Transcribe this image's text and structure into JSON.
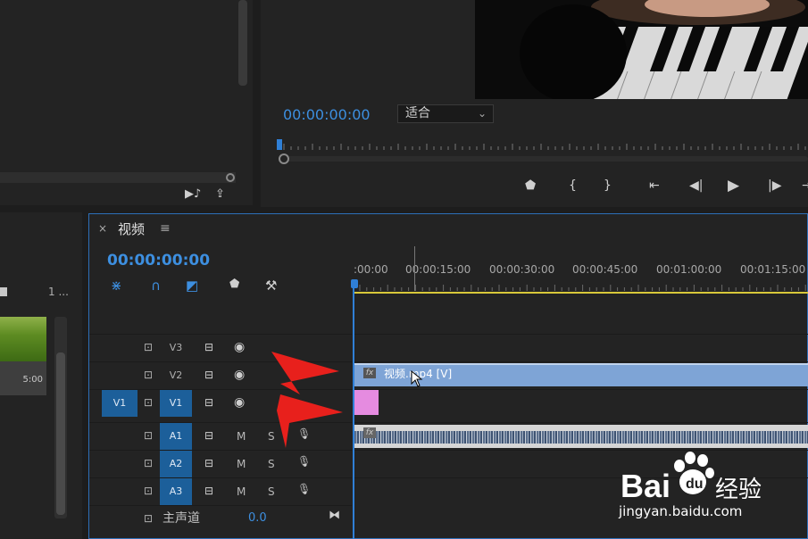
{
  "program_monitor": {
    "timecode": "00:00:00:00",
    "fit_dropdown": {
      "selected": "适合"
    }
  },
  "project_panel": {
    "column_header": "1 ...",
    "clip_duration": "5:00"
  },
  "timeline": {
    "tab_title": "视频",
    "close_glyph": "×",
    "menu_glyph": "≡",
    "timecode": "00:00:00:00",
    "ruler_labels": [
      ":00:00",
      "00:00:15:00",
      "00:00:30:00",
      "00:00:45:00",
      "00:01:00:00",
      "00:01:15:00"
    ],
    "video_tracks": [
      {
        "name": "V3",
        "targeted": false
      },
      {
        "name": "V2",
        "targeted": false
      },
      {
        "name": "V1",
        "targeted": true,
        "source": "V1"
      }
    ],
    "audio_tracks": [
      {
        "name": "A1",
        "mute": "M",
        "solo": "S"
      },
      {
        "name": "A2",
        "mute": "M",
        "solo": "S"
      },
      {
        "name": "A3",
        "mute": "M",
        "solo": "S"
      }
    ],
    "master": {
      "label": "主声道",
      "value": "0.0"
    },
    "clip_v2_label": "视频.mp4 [V]",
    "fx_badge": "fx"
  },
  "icons": {
    "lock": "lock-icon",
    "eye": "eye-icon",
    "sync": "sync-lock-icon",
    "mic": "microphone-icon"
  },
  "watermark": {
    "brand_text": "Bai",
    "brand_suffix": "经验",
    "url": "jingyan.baidu.com"
  },
  "colors": {
    "accent_blue": "#3d8fe0",
    "track_target": "#1c5f9a",
    "clip_video": "#7ea4d6",
    "clip_v1": "#e58be0",
    "arrow_red": "#e8201c"
  }
}
